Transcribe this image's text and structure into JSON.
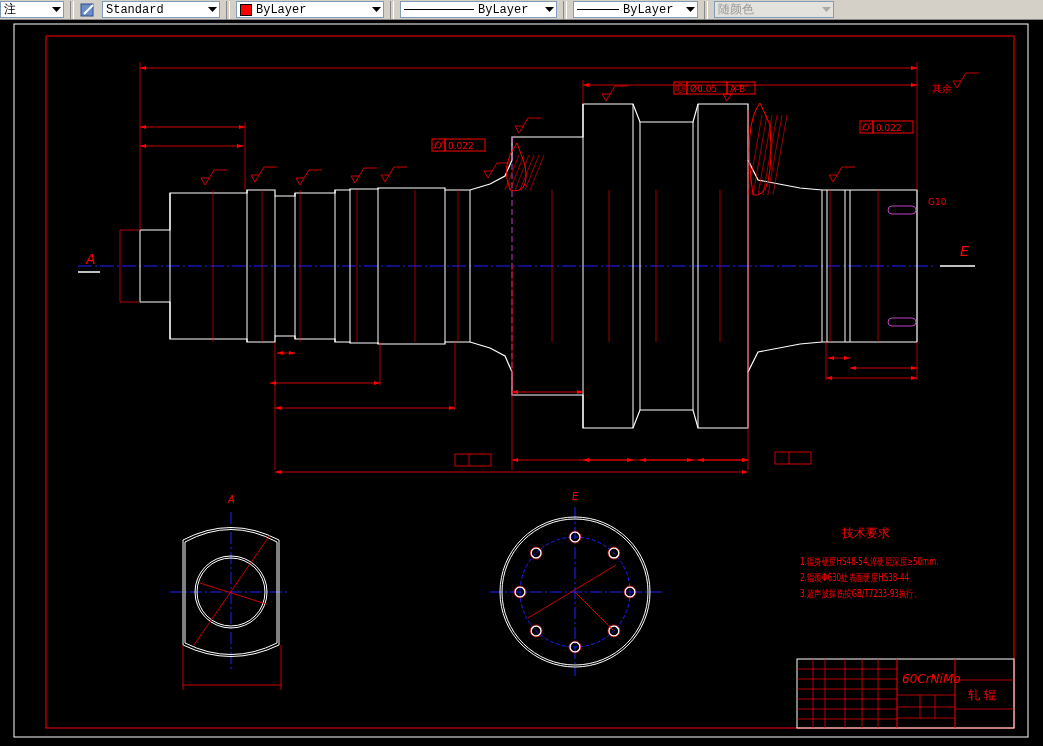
{
  "toolbar": {
    "controls": [
      {
        "kind": "dimstyle",
        "label": "注",
        "disabled": false
      },
      {
        "kind": "textstyle",
        "label": "Standard",
        "disabled": false
      },
      {
        "kind": "color",
        "label": "ByLayer",
        "color": "#ff0000",
        "disabled": false
      },
      {
        "kind": "linetype",
        "label": "ByLayer",
        "disabled": false
      },
      {
        "kind": "lineweight",
        "label": "ByLayer",
        "disabled": false
      },
      {
        "kind": "plotstyle",
        "label": "随颜色",
        "disabled": true
      }
    ]
  },
  "drawing": {
    "view_labels": [
      "A",
      "E",
      "A",
      "E"
    ],
    "tolerance_frames": [
      {
        "kind": "cylindricity",
        "cells": [
          "0.022"
        ]
      },
      {
        "kind": "concentricity",
        "cells": [
          "Ø0.05",
          "A-B"
        ]
      },
      {
        "kind": "cylindricity",
        "cells": [
          "0.022"
        ]
      }
    ],
    "roughness_note": "其余",
    "thread_label": "G10",
    "notes": {
      "title": "技术要求",
      "lines": [
        "1.辊身硬度HS48-54,淬硬层深度≥50mm.",
        "2.辊颈Φ630处表面硬度HS38-44。",
        "3.超声波探伤按GB/T7233-93执行。"
      ]
    },
    "title_block": {
      "material": "60CrNiMo",
      "part_name": "轧 辊"
    }
  }
}
